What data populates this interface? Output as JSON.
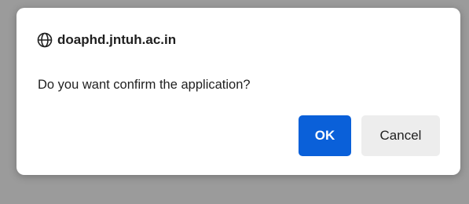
{
  "dialog": {
    "origin": "doaphd.jntuh.ac.in",
    "origin_icon": "globe-icon",
    "message": "Do you want confirm the application?",
    "ok_label": "OK",
    "cancel_label": "Cancel"
  },
  "colors": {
    "backdrop": "#9b9b9b",
    "dialog_bg": "#ffffff",
    "ok_bg": "#0a60d9",
    "cancel_bg": "#ededed"
  }
}
